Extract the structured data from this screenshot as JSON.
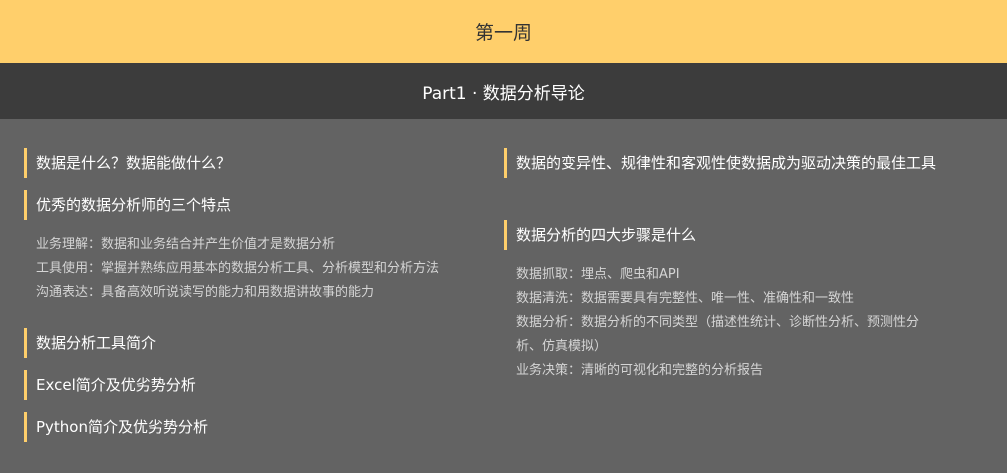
{
  "week_title": "第一周",
  "part_title": "Part1 · 数据分析导论",
  "left": {
    "h1": "数据是什么？数据能做什么？",
    "h2": "优秀的数据分析师的三个特点",
    "traits": [
      "业务理解：数据和业务结合并产生价值才是数据分析",
      "工具使用：掌握并熟练应用基本的数据分析工具、分析模型和分析方法",
      "沟通表达：具备高效听说读写的能力和用数据讲故事的能力"
    ],
    "h3": "数据分析工具简介",
    "h4": "Excel简介及优劣势分析",
    "h5": "Python简介及优劣势分析"
  },
  "right": {
    "h1": "数据的变异性、规律性和客观性使数据成为驱动决策的最佳工具",
    "h2": "数据分析的四大步骤是什么",
    "steps": [
      "数据抓取：埋点、爬虫和API",
      "数据清洗：数据需要具有完整性、唯一性、准确性和一致性",
      "数据分析：数据分析的不同类型（描述性统计、诊断性分析、预测性分析、仿真模拟）",
      "业务决策：清晰的可视化和完整的分析报告"
    ]
  },
  "colors": {
    "accent": "#ffcf6b",
    "dark_band": "#3c3c3c",
    "panel": "#636363"
  }
}
